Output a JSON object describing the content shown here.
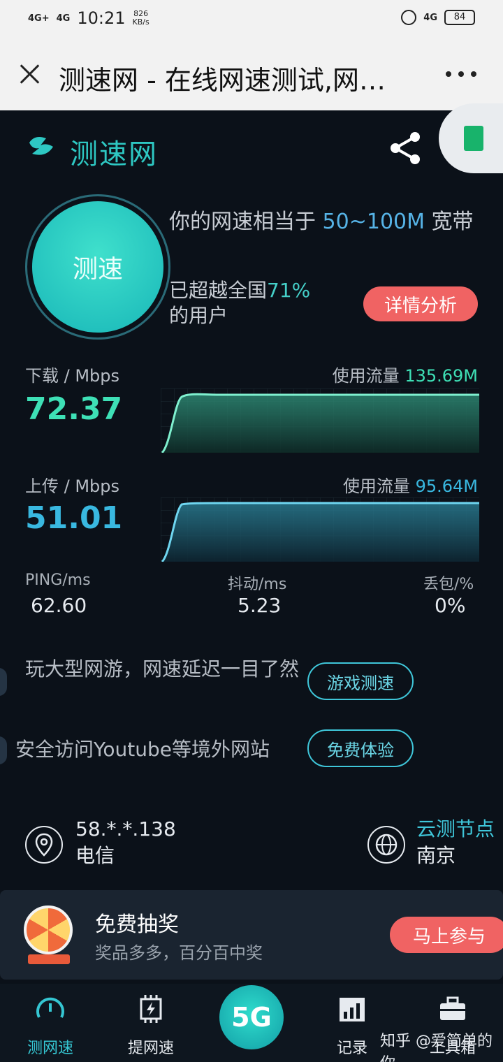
{
  "status_bar": {
    "signal_left": "4G+",
    "signal_right": "4G",
    "time": "10:21",
    "net_speed_value": "826",
    "net_speed_unit": "KB/s",
    "network_right": "4G",
    "battery": "84"
  },
  "titlebar": {
    "title": "测速网 - 在线网速测试,网…",
    "close_icon": "close-icon",
    "more_icon": "more-icon"
  },
  "header": {
    "brand": "测速网",
    "share_icon": "share-icon"
  },
  "speed_test": {
    "button_label": "测速",
    "line1_prefix": "你的网速相当于",
    "bandwidth": "50~100M",
    "line1_suffix": "宽带",
    "line2_prefix": "已超越全国",
    "percentile": "71%",
    "line2_suffix": "的用户",
    "detail_button": "详情分析"
  },
  "download": {
    "label": "下载 / Mbps",
    "value": "72.37",
    "usage_label": "使用流量",
    "usage_value": "135.69M",
    "color": "#3ee0b6"
  },
  "upload": {
    "label": "上传 / Mbps",
    "value": "51.01",
    "usage_label": "使用流量",
    "usage_value": "95.64M",
    "color": "#39b8e0"
  },
  "stats": {
    "ping_label": "PING/ms",
    "ping_value": "62.60",
    "jitter_label": "抖动/ms",
    "jitter_value": "5.23",
    "loss_label": "丢包/%",
    "loss_value": "0%"
  },
  "promos": {
    "game_text": "玩大型网游，网速延迟一目了然",
    "game_button": "游戏测速",
    "youtube_text": "安全访问Youtube等境外网站",
    "youtube_button": "免费体验"
  },
  "connection": {
    "ip": "58.*.*.138",
    "isp": "电信",
    "node_label": "云测节点",
    "node_city": "南京"
  },
  "lottery": {
    "title": "免费抽奖",
    "subtitle": "奖品多多，百分百中奖",
    "button": "马上参与"
  },
  "bottom_nav": {
    "items": [
      {
        "label": "测网速",
        "icon": "gauge-icon"
      },
      {
        "label": "提网速",
        "icon": "chip-icon"
      },
      {
        "label": "5G",
        "icon": "5g-icon"
      },
      {
        "label": "记录",
        "icon": "calendar-chart-icon"
      },
      {
        "label": "工具箱",
        "icon": "toolbox-icon"
      }
    ]
  },
  "watermark": "知乎 @爱简单的你"
}
